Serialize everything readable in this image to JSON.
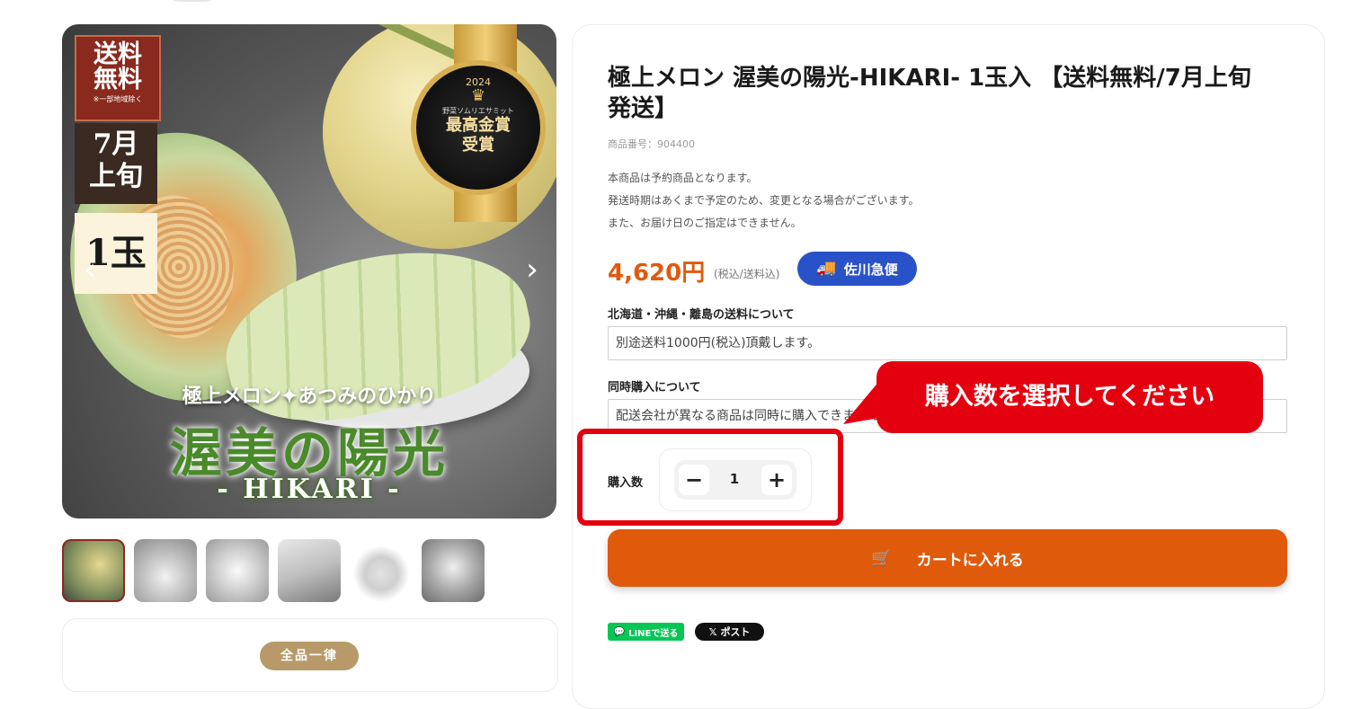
{
  "gallery": {
    "main_image": {
      "badge_shipping": "送料\n無料",
      "badge_shipping_note": "※一部地域除く",
      "badge_month": "7月\n上旬",
      "badge_qty": "1玉",
      "award_year": "2024",
      "award_org": "野菜ソムリエサミット",
      "award_text": "最高金賞\n受賞",
      "caption_sub": "極上メロン✦あつみのひかり",
      "caption_main": "渥美の陽光",
      "caption_en": "- HIKARI -"
    },
    "prev_icon": "‹",
    "next_icon": "›",
    "thumbnail_count": 6,
    "active_thumbnail": 1
  },
  "promo": {
    "pill": "全品一律"
  },
  "product": {
    "title": "極上メロン 渥美の陽光-HIKARI- 1玉入 【送料無料/7月上旬発送】",
    "sku": "商品番号：904400",
    "notes": [
      "本商品は予約商品となります。",
      "発送時期はあくまで予定のため、変更となる場合がございます。",
      "また、お届け日のご指定はできません。"
    ],
    "price": "4,620円",
    "tax_note": "(税込/送料込)",
    "shipping_carrier": "佐川急便",
    "fields": [
      {
        "label": "北海道・沖縄・離島の送料について",
        "value": "別途送料1000円(税込)頂戴します。"
      },
      {
        "label": "同時購入について",
        "value": "配送会社が異なる商品は同時に購入できません。"
      }
    ],
    "quantity_label": "購入数",
    "quantity": "1",
    "qty_minus": "−",
    "qty_plus": "+",
    "cart_button": "カートに入れる",
    "tooltip": "購入数を選択してください"
  },
  "share": {
    "line_label": "LINEで送る",
    "x_label": "ポスト",
    "x_logo": "𝕏"
  },
  "colors": {
    "price": "#e05a0c",
    "cart_button": "#e05a0c",
    "shipping_badge": "#2a52c8",
    "highlight": "#e3000f",
    "line_green": "#06c755"
  }
}
